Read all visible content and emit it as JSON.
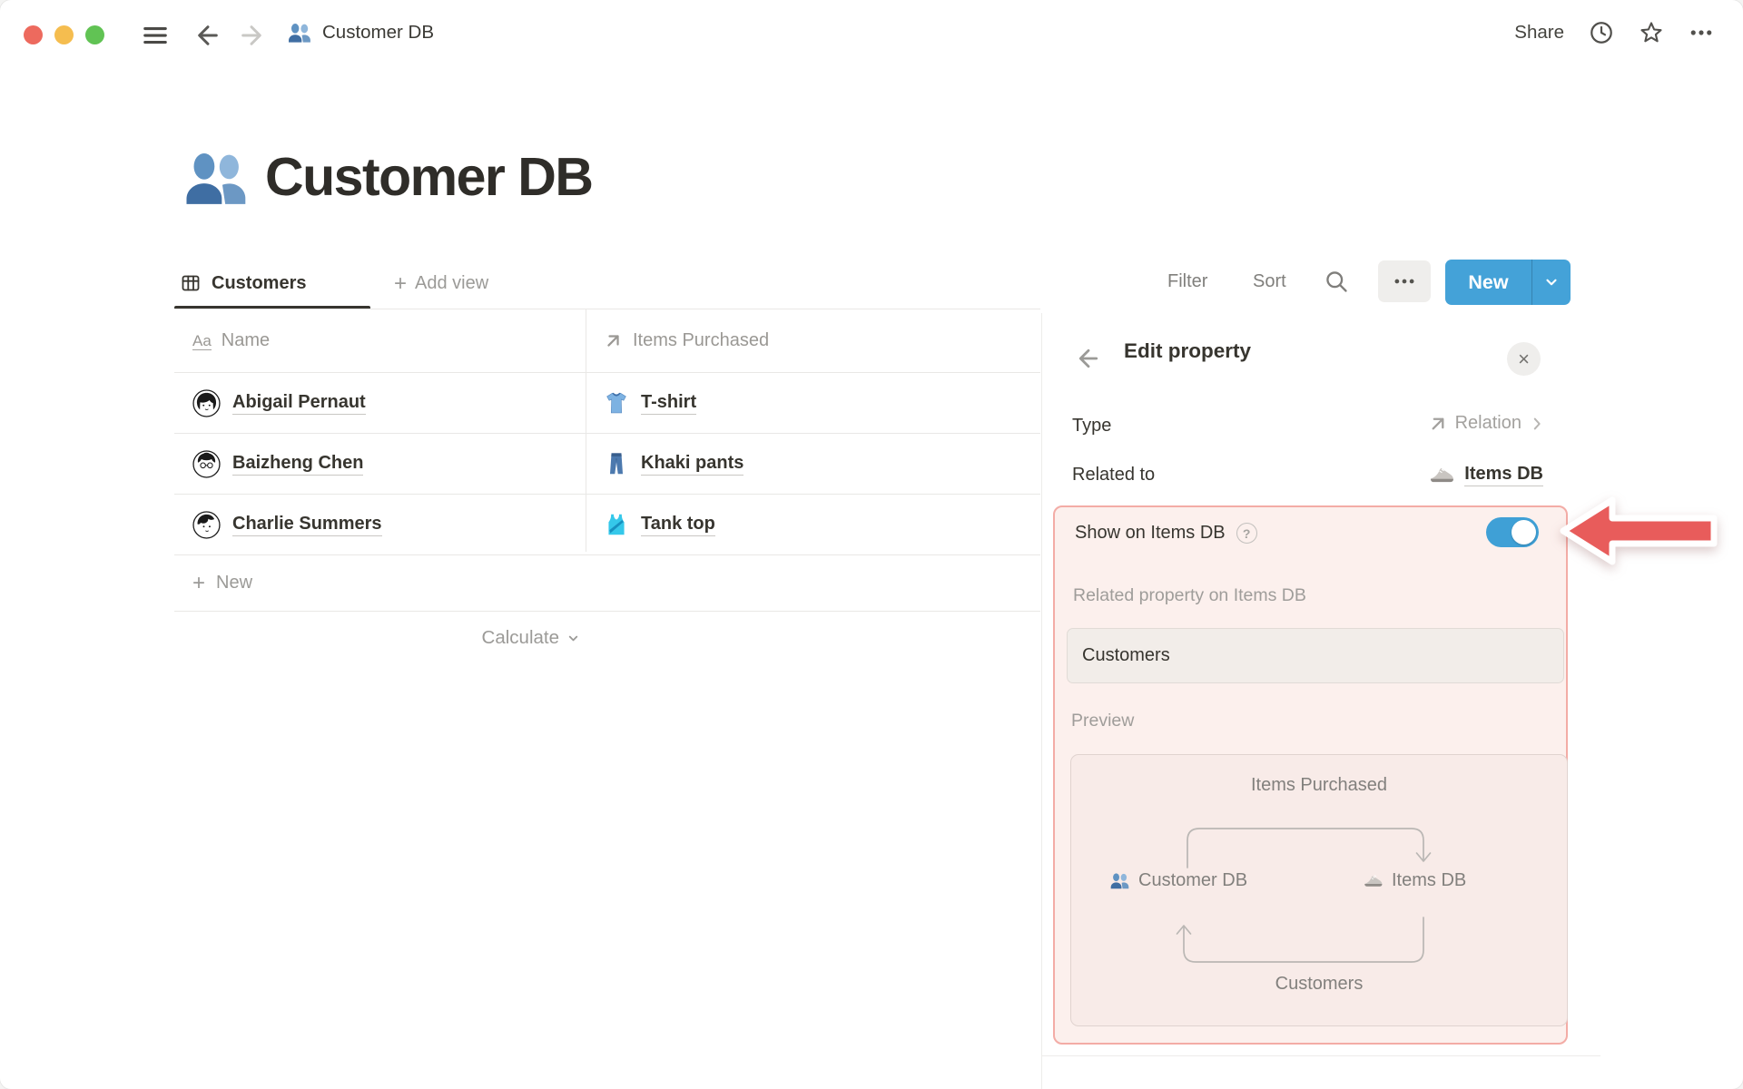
{
  "topbar": {
    "window_controls": [
      "close",
      "minimize",
      "zoom"
    ],
    "icons": [
      "menu-icon",
      "back-icon",
      "forward-icon",
      "clock-icon",
      "star-icon",
      "ellipsis-icon"
    ],
    "breadcrumb": {
      "icon": "people-icon",
      "label": "Customer DB"
    },
    "share_label": "Share"
  },
  "page": {
    "icon": "people-icon",
    "title": "Customer DB"
  },
  "views": {
    "tabs": [
      {
        "icon": "table-view-icon",
        "label": "Customers",
        "active": true
      }
    ],
    "add_view_label": "Add view"
  },
  "toolbar": {
    "filter_label": "Filter",
    "sort_label": "Sort",
    "icons": [
      "search-icon",
      "more-options-icon"
    ],
    "new_button": {
      "label": "New",
      "icon": "chevron-down-icon"
    }
  },
  "table": {
    "columns": [
      {
        "icon": "text-type-icon",
        "label": "Name"
      },
      {
        "icon": "relation-arrow-icon",
        "label": "Items Purchased"
      }
    ],
    "rows": [
      {
        "avatar": "avatar-abigail",
        "name": "Abigail Pernaut",
        "item_icon": "tshirt-icon",
        "item": "T-shirt"
      },
      {
        "avatar": "avatar-baizheng",
        "name": "Baizheng Chen",
        "item_icon": "jeans-icon",
        "item": "Khaki pants"
      },
      {
        "avatar": "avatar-charlie",
        "name": "Charlie Summers",
        "item_icon": "tanktop-icon",
        "item": "Tank top"
      }
    ],
    "new_row_label": "New",
    "calculate_label": "Calculate"
  },
  "panel": {
    "title": "Edit property",
    "rows": {
      "type": {
        "label": "Type",
        "value": "Relation",
        "value_icon": "relation-arrow-icon",
        "chevron": "chevron-right-icon"
      },
      "related_to": {
        "label": "Related to",
        "value": "Items DB",
        "value_icon": "sneaker-icon"
      }
    },
    "highlight": {
      "show_on": {
        "label": "Show on Items DB",
        "help_icon": "question-icon",
        "toggle_on": true
      },
      "related_property": {
        "label": "Related property on Items DB",
        "value": "Customers"
      },
      "preview": {
        "label": "Preview",
        "top_property": "Items Purchased",
        "left_db": {
          "icon": "people-icon",
          "label": "Customer DB"
        },
        "right_db": {
          "icon": "sneaker-icon",
          "label": "Items DB"
        },
        "bottom_property": "Customers"
      }
    }
  },
  "annotation": {
    "icon": "arrow-left-red"
  },
  "colors": {
    "accent_blue": "#44A2D8",
    "toggle_blue": "#3FA0D6",
    "highlight_border": "#F3ACA6",
    "highlight_bg": "#FCF0ED",
    "arrow_red": "#E85C5B"
  }
}
